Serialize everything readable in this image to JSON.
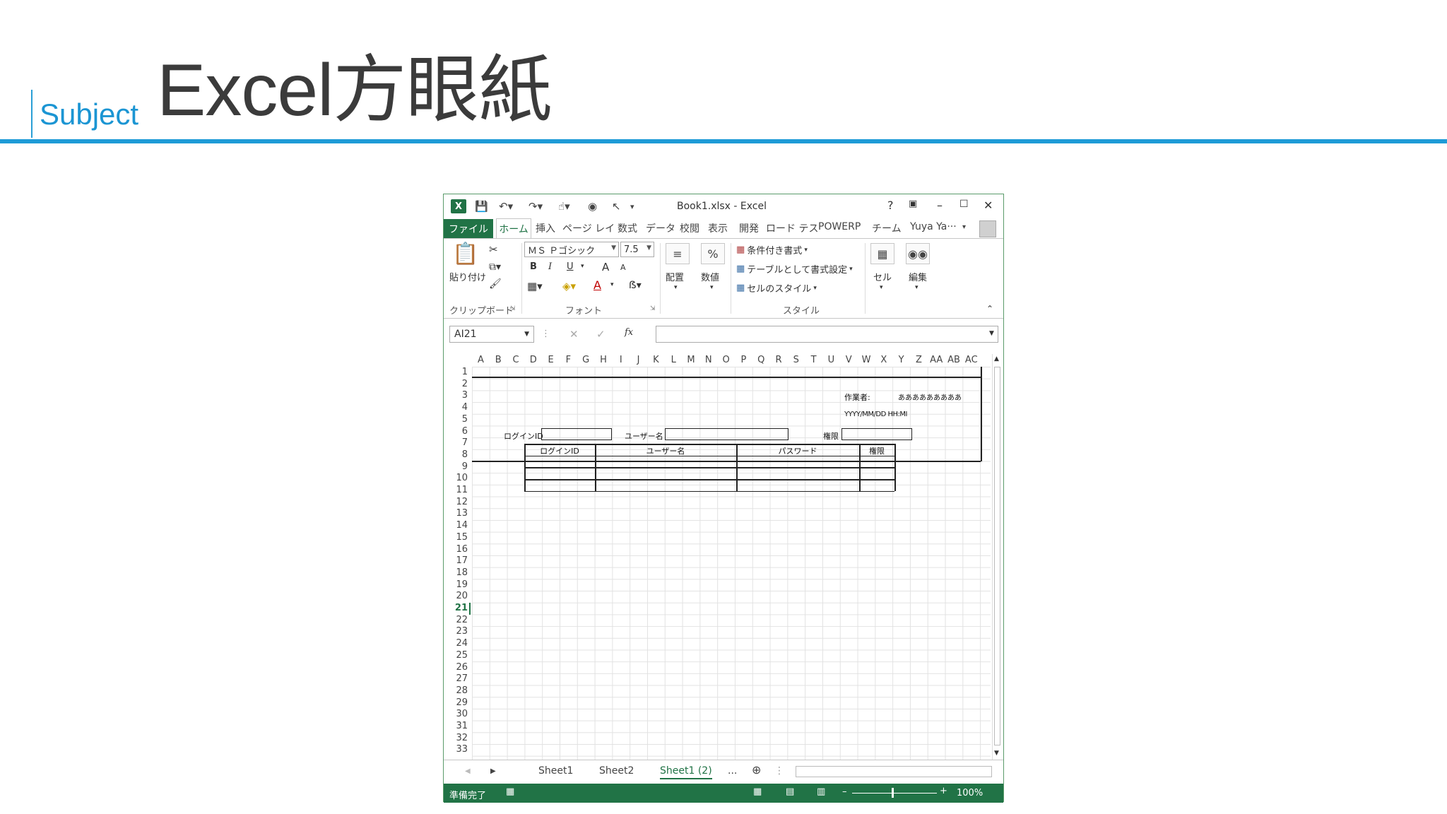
{
  "slide": {
    "subject_label": "Subject",
    "title": "Excel方眼紙"
  },
  "excel": {
    "window_title": "Book1.xlsx - Excel",
    "help": "?",
    "tabs": {
      "file": "ファイル",
      "home": "ホーム",
      "insert": "挿入",
      "page_layout": "ページ レイ",
      "formulas": "数式",
      "data": "データ",
      "review": "校閲",
      "view": "表示",
      "developer": "開発",
      "load_test": "ロード テス",
      "powerp": "POWERP",
      "team": "チーム",
      "user": "Yuya Ya···"
    },
    "ribbon": {
      "paste": "貼り付け",
      "clipboard": "クリップボード",
      "font_name": "ＭＳ Ｐゴシック",
      "font_size": "7.5",
      "bold": "B",
      "italic": "I",
      "underline": "U",
      "grow_font": "A",
      "shrink_font": "A",
      "font_color": "A",
      "font_group": "フォント",
      "alignment": "配置",
      "number": "数値",
      "conditional_formatting": "条件付き書式",
      "format_as_table": "テーブルとして書式設定",
      "cell_styles": "セルのスタイル",
      "styles_group": "スタイル",
      "cells": "セル",
      "editing": "編集"
    },
    "formula_bar": {
      "name_box": "AI21",
      "fx": "fx"
    },
    "columns": [
      "A",
      "B",
      "C",
      "D",
      "E",
      "F",
      "G",
      "H",
      "I",
      "J",
      "K",
      "L",
      "M",
      "N",
      "O",
      "P",
      "Q",
      "R",
      "S",
      "T",
      "U",
      "V",
      "W",
      "X",
      "Y",
      "Z",
      "AA",
      "AB",
      "AC"
    ],
    "rows": [
      "1",
      "2",
      "3",
      "4",
      "5",
      "6",
      "7",
      "8",
      "9",
      "10",
      "11",
      "12",
      "13",
      "14",
      "15",
      "16",
      "17",
      "18",
      "19",
      "20",
      "21",
      "22",
      "23",
      "24",
      "25",
      "26",
      "27",
      "28",
      "29",
      "30",
      "31",
      "32",
      "33"
    ],
    "cells": {
      "worker_label": "作業者:",
      "worker_value": "あああああああああ",
      "datetime": "YYYY/MM/DD HH:MI",
      "login_id_label": "ログインID",
      "user_name_label": "ユーザー名",
      "permission_label": "権限",
      "table_headers": [
        "ログインID",
        "ユーザー名",
        "パスワード",
        "権限"
      ]
    },
    "sheet_tabs": [
      "Sheet1",
      "Sheet2",
      "Sheet1 (2)"
    ],
    "sheet_more": "...",
    "status": {
      "ready": "準備完了",
      "zoom": "100%"
    },
    "colors": {
      "accent": "#217346",
      "slide_blue": "#1e9bd7"
    }
  }
}
